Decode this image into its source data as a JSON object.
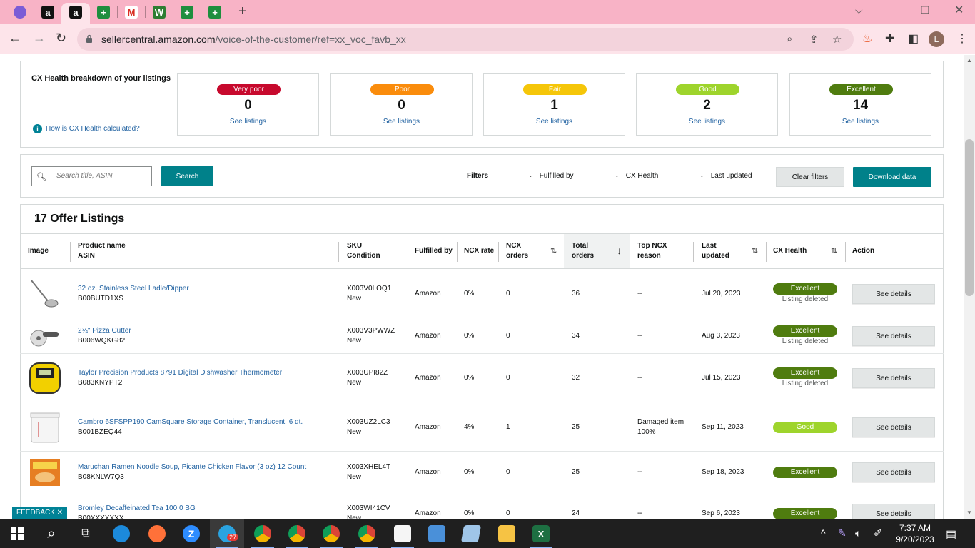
{
  "browser": {
    "url_domain": "sellercentral.amazon.com",
    "url_path": "/voice-of-the-customer/ref=xx_voc_favb_xx",
    "avatar_letter": "L",
    "new_tab_label": "+",
    "tabs": [
      {
        "icon": "messenger-icon",
        "color": "#7b5cd6",
        "letter": ""
      },
      {
        "icon": "amazon-icon",
        "color": "#111111",
        "letter": "a"
      },
      {
        "icon": "amazon-icon",
        "color": "#111111",
        "letter": "a"
      },
      {
        "icon": "sheets-icon",
        "color": "#1e8e3e",
        "letter": "+"
      },
      {
        "icon": "gmail-icon",
        "color": "#ffffff",
        "letter": "M"
      },
      {
        "icon": "app-icon",
        "color": "#2e7d32",
        "letter": "W"
      },
      {
        "icon": "sheets-icon",
        "color": "#1e8e3e",
        "letter": "+"
      },
      {
        "icon": "sheets-icon",
        "color": "#1e8e3e",
        "letter": "+"
      }
    ]
  },
  "health": {
    "title": "CX Health breakdown of your listings",
    "info_link": "How is CX Health calculated?",
    "cards": [
      {
        "label": "Very poor",
        "count": "0",
        "link": "See listings",
        "color": "#c7092d"
      },
      {
        "label": "Poor",
        "count": "0",
        "link": "See listings",
        "color": "#fa8c0c"
      },
      {
        "label": "Fair",
        "count": "1",
        "link": "See listings",
        "color": "#f5c609"
      },
      {
        "label": "Good",
        "count": "2",
        "link": "See listings",
        "color": "#9ed42c"
      },
      {
        "label": "Excellent",
        "count": "14",
        "link": "See listings",
        "color": "#4f7c0f"
      }
    ]
  },
  "filters": {
    "search_placeholder": "Search title, ASIN",
    "search_button": "Search",
    "filters_label": "Filters",
    "dropdowns": [
      "Fulfilled by",
      "CX Health",
      "Last updated"
    ],
    "clear_button": "Clear filters",
    "download_button": "Download data"
  },
  "listings": {
    "title": "17 Offer Listings",
    "headers": {
      "image": "Image",
      "product_1": "Product name",
      "product_2": "ASIN",
      "sku_1": "SKU",
      "sku_2": "Condition",
      "fulfilled": "Fulfilled by",
      "ncx_rate": "NCX rate",
      "ncx_orders_1": "NCX",
      "ncx_orders_2": "orders",
      "total_1": "Total",
      "total_2": "orders",
      "reason_1": "Top NCX",
      "reason_2": "reason",
      "updated_1": "Last",
      "updated_2": "updated",
      "health": "CX Health",
      "action": "Action"
    },
    "rows": [
      {
        "name": "32 oz. Stainless Steel Ladle/Dipper",
        "asin": "B00BUTD1XS",
        "sku": "X003V0LOQ1",
        "condition": "New",
        "fulfilled": "Amazon",
        "ncx_rate": "0%",
        "ncx_orders": "0",
        "total_orders": "36",
        "reason_1": "--",
        "reason_2": "",
        "updated": "Jul 20, 2023",
        "health": "Excellent",
        "health_color": "#4f7c0f",
        "substatus": "Listing deleted",
        "action": "See details",
        "image": "ladle"
      },
      {
        "name": "2¾\" Pizza Cutter",
        "asin": "B006WQKG82",
        "sku": "X003V3PWWZ",
        "condition": "New",
        "fulfilled": "Amazon",
        "ncx_rate": "0%",
        "ncx_orders": "0",
        "total_orders": "34",
        "reason_1": "--",
        "reason_2": "",
        "updated": "Aug 3, 2023",
        "health": "Excellent",
        "health_color": "#4f7c0f",
        "substatus": "Listing deleted",
        "action": "See details",
        "image": "cutter"
      },
      {
        "name": "Taylor Precision Products 8791 Digital Dishwasher Thermometer",
        "asin": "B083KNYPT2",
        "sku": "X003UPI82Z",
        "condition": "New",
        "fulfilled": "Amazon",
        "ncx_rate": "0%",
        "ncx_orders": "0",
        "total_orders": "32",
        "reason_1": "--",
        "reason_2": "",
        "updated": "Jul 15, 2023",
        "health": "Excellent",
        "health_color": "#4f7c0f",
        "substatus": "Listing deleted",
        "action": "See details",
        "image": "thermo"
      },
      {
        "name": "Cambro 6SFSPP190 CamSquare Storage Container, Translucent, 6 qt.",
        "asin": "B001BZEQ44",
        "sku": "X003UZ2LC3",
        "condition": "New",
        "fulfilled": "Amazon",
        "ncx_rate": "4%",
        "ncx_orders": "1",
        "total_orders": "25",
        "reason_1": "Damaged item",
        "reason_2": "100%",
        "updated": "Sep 11, 2023",
        "health": "Good",
        "health_color": "#9ed42c",
        "substatus": "",
        "action": "See details",
        "image": "container"
      },
      {
        "name": "Maruchan Ramen Noodle Soup, Picante Chicken Flavor (3 oz) 12 Count",
        "asin": "B08KNLW7Q3",
        "sku": "X003XHEL4T",
        "condition": "New",
        "fulfilled": "Amazon",
        "ncx_rate": "0%",
        "ncx_orders": "0",
        "total_orders": "25",
        "reason_1": "--",
        "reason_2": "",
        "updated": "Sep 18, 2023",
        "health": "Excellent",
        "health_color": "#4f7c0f",
        "substatus": "",
        "action": "See details",
        "image": "ramen"
      },
      {
        "name": "Bromley Decaffeinated Tea 100.0 BG",
        "asin": "B00XXXXXXX",
        "sku": "X003WI41CV",
        "condition": "New",
        "fulfilled": "Amazon",
        "ncx_rate": "0%",
        "ncx_orders": "0",
        "total_orders": "24",
        "reason_1": "--",
        "reason_2": "",
        "updated": "Sep 6, 2023",
        "health": "Excellent",
        "health_color": "#4f7c0f",
        "substatus": "",
        "action": "See details",
        "image": "tea"
      }
    ]
  },
  "feedback_label": "FEEDBACK ✕",
  "taskbar": {
    "time": "7:37 AM",
    "date": "9/20/2023",
    "telegram_badge": "27"
  }
}
